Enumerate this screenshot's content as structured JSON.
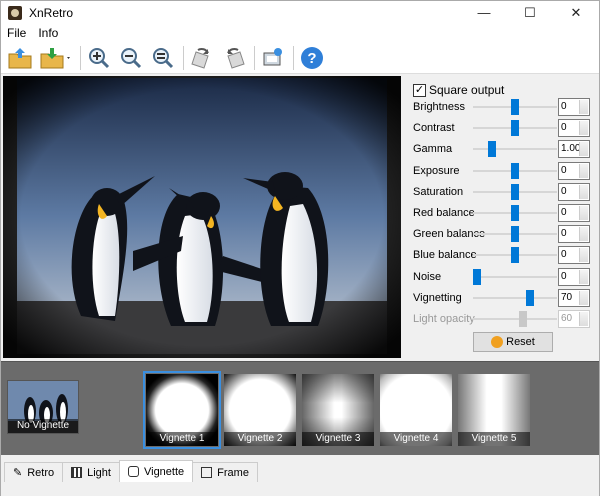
{
  "window": {
    "title": "XnRetro",
    "minimize": "—",
    "maximize": "☐",
    "close": "✕"
  },
  "menu": [
    {
      "label": "File"
    },
    {
      "label": "Info"
    }
  ],
  "toolbar": [
    "open-folder-icon",
    "save-folder-icon",
    "zoom-in-icon",
    "zoom-out-icon",
    "zoom-fit-icon",
    "rotate-left-icon",
    "rotate-right-icon",
    "screen-capture-icon",
    "help-icon"
  ],
  "panel": {
    "square_output": "Square output",
    "params": [
      {
        "label": "Brightness",
        "value": "0",
        "level": 0.5
      },
      {
        "label": "Contrast",
        "value": "0",
        "level": 0.5
      },
      {
        "label": "Gamma",
        "value": "1.00",
        "level": 0.2
      },
      {
        "label": "Exposure",
        "value": "0",
        "level": 0.5
      },
      {
        "label": "Saturation",
        "value": "0",
        "level": 0.5
      },
      {
        "label": "Red balance",
        "value": "0",
        "level": 0.5
      },
      {
        "label": "Green balance",
        "value": "0",
        "level": 0.5
      },
      {
        "label": "Blue balance",
        "value": "0",
        "level": 0.5
      },
      {
        "label": "Noise",
        "value": "0",
        "level": 0.0
      },
      {
        "label": "Vignetting",
        "value": "70",
        "level": 0.7
      },
      {
        "label": "Light opacity",
        "value": "60",
        "level": 0.6,
        "disabled": true
      }
    ],
    "reset": "Reset"
  },
  "strip": {
    "no_vignette": "No Vignette",
    "items": [
      {
        "label": "Vignette 1"
      },
      {
        "label": "Vignette 2"
      },
      {
        "label": "Vignette 3"
      },
      {
        "label": "Vignette 4"
      },
      {
        "label": "Vignette 5"
      }
    ]
  },
  "tabs": [
    {
      "label": "Retro"
    },
    {
      "label": "Light"
    },
    {
      "label": "Vignette"
    },
    {
      "label": "Frame"
    }
  ]
}
